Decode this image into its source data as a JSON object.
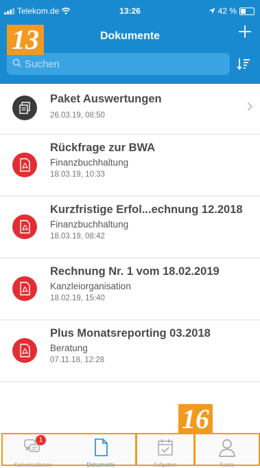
{
  "status_bar": {
    "carrier": "Telekom.de",
    "time": "13:26",
    "battery": "42 %",
    "battery_level": 0.42
  },
  "nav": {
    "title": "Dokumente",
    "add_icon": "plus-icon"
  },
  "search": {
    "placeholder": "Suchen",
    "sort_icon": "sort-icon"
  },
  "callouts": {
    "top": "13",
    "bottom": "16"
  },
  "colors": {
    "header": "#1a8ad0",
    "search_field": "#3aa4e3",
    "pdf_icon": "#e42d33",
    "folder_icon": "#3a3a3a",
    "callout": "#f29a1f",
    "active_tab": "#1a8ad0"
  },
  "documents": [
    {
      "title": "Paket Auswertungen",
      "category": "",
      "date": "26.03.19, 08:50",
      "icon": "package-icon",
      "has_chevron": true
    },
    {
      "title": "Rückfrage zur BWA",
      "category": "Finanzbuchhaltung",
      "date": "18.03.19, 10:33",
      "icon": "pdf-icon"
    },
    {
      "title": "Kurzfristige Erfol...echnung 12.2018",
      "category": "Finanzbuchhaltung",
      "date": "18.03.19, 08:42",
      "icon": "pdf-icon"
    },
    {
      "title": "Rechnung Nr. 1 vom 18.02.2019",
      "category": "Kanzleiorganisation",
      "date": "18.02.19, 15:40",
      "icon": "pdf-icon"
    },
    {
      "title": "Plus Monatsreporting 03.2018",
      "category": "Beratung",
      "date": "07.11.18, 12:28",
      "icon": "pdf-icon"
    }
  ],
  "tabs": [
    {
      "label": "Konversationen",
      "icon": "chat-icon",
      "badge": "1"
    },
    {
      "label": "Dokumente",
      "icon": "document-icon",
      "active": true
    },
    {
      "label": "Aufgaben",
      "icon": "calendar-check-icon"
    },
    {
      "label": "Konto",
      "icon": "user-icon"
    }
  ]
}
